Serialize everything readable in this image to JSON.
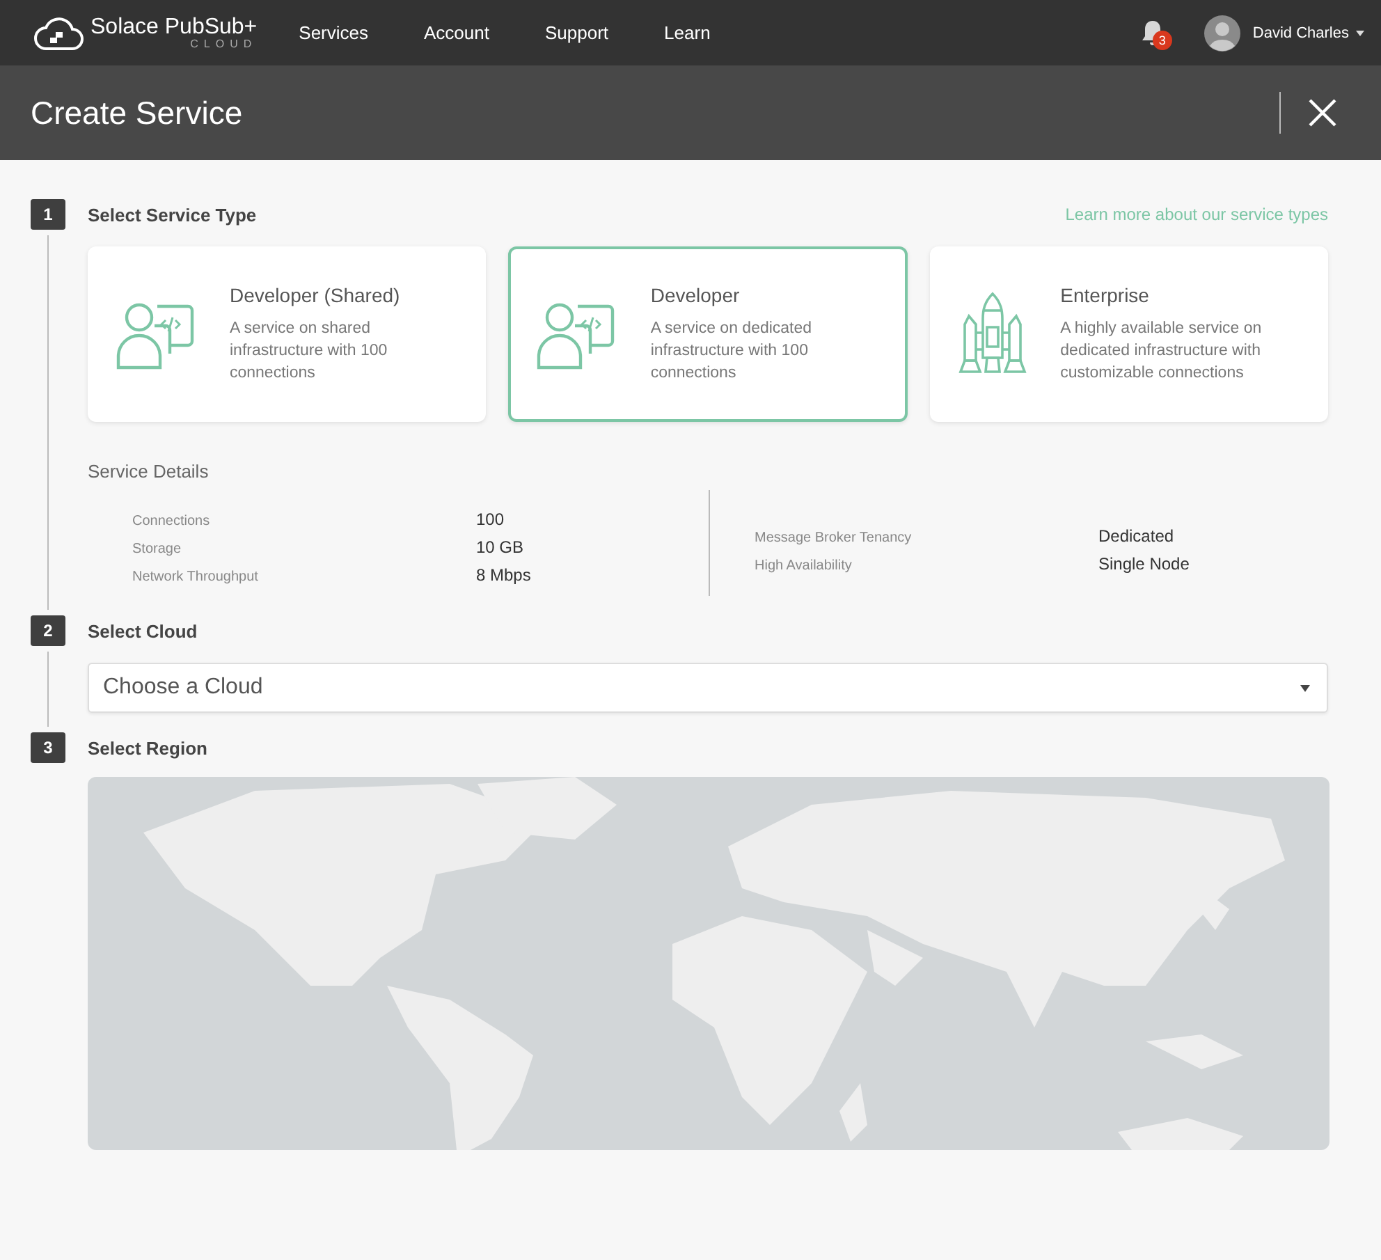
{
  "nav": {
    "logo": "Solace PubSub+",
    "logo_sub": "CLOUD",
    "items": [
      "Services",
      "Account",
      "Support",
      "Learn"
    ],
    "notifications": "3",
    "user": "David Charles"
  },
  "header": {
    "title": "Create Service"
  },
  "step1": {
    "number": "1",
    "title": "Select Service Type",
    "link": "Learn more about our service types",
    "cards": [
      {
        "kind": "person",
        "title": "Developer (Shared)",
        "text": "A service on shared infrastructure with 100 connections",
        "selected": false
      },
      {
        "kind": "person",
        "title": "Developer",
        "text": "A service on dedicated infrastructure with 100 connections",
        "selected": true
      },
      {
        "kind": "rocket",
        "title": "Enterprise",
        "text": "A highly available service on dedicated infrastructure with customizable connections",
        "selected": false
      }
    ],
    "details_title": "Service Details",
    "details_left": [
      {
        "label": "Connections",
        "value": "100"
      },
      {
        "label": "Storage",
        "value": "10 GB"
      },
      {
        "label": "Network Throughput",
        "value": "8 Mbps"
      }
    ],
    "details_right": [
      {
        "label": "Message Broker Tenancy",
        "value": "Dedicated"
      },
      {
        "label": "High Availability",
        "value": "Single Node"
      }
    ]
  },
  "step2": {
    "number": "2",
    "title": "Select Cloud",
    "placeholder": "Choose a Cloud"
  },
  "step3": {
    "number": "3",
    "title": "Select Region"
  }
}
